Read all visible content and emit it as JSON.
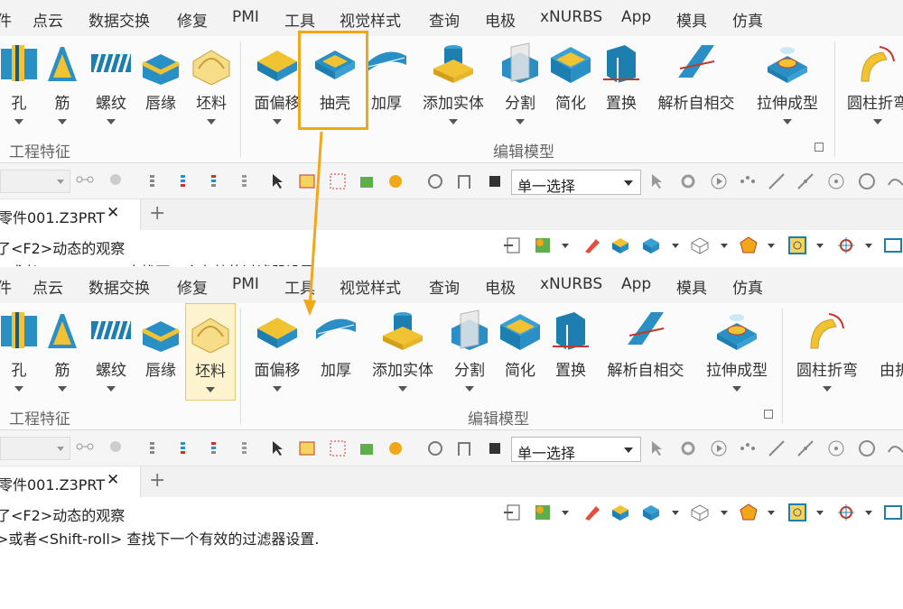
{
  "menu": [
    "件",
    "点云",
    "数据交换",
    "修复",
    "PMI",
    "工具",
    "视觉样式",
    "查询",
    "电极",
    "xNURBS",
    "App",
    "模具",
    "仿真"
  ],
  "panel1": {
    "buttons": [
      "孔",
      "筋",
      "螺纹",
      "唇缘",
      "坯料",
      "面偏移",
      "抽壳",
      "加厚",
      "添加实体",
      "分割",
      "简化",
      "置换",
      "解析自相交",
      "拉伸成型",
      "圆柱折弯"
    ]
  },
  "panel2": {
    "buttons": [
      "孔",
      "筋",
      "螺纹",
      "唇缘",
      "坯料",
      "面偏移",
      "加厚",
      "添加实体",
      "分割",
      "简化",
      "置换",
      "解析自相交",
      "拉伸成型",
      "圆柱折弯",
      "由折"
    ]
  },
  "groups": {
    "engineering": "工程特征",
    "edit_model": "编辑模型"
  },
  "toolbar": {
    "select_mode": "单一选择"
  },
  "document": {
    "tab_title": "零件001.Z3PRT",
    "close": "✕",
    "add": "+"
  },
  "hints": {
    "line1": "<F2>动态的观察",
    "line2": ">或者<Shift-roll> 查找下一个有效的过滤器设置.",
    "line1_prefix": "了"
  },
  "colors": {
    "highlight_box": "#f0a818",
    "arrow": "#f0a818",
    "hover_bg": "#fdf3cf"
  }
}
